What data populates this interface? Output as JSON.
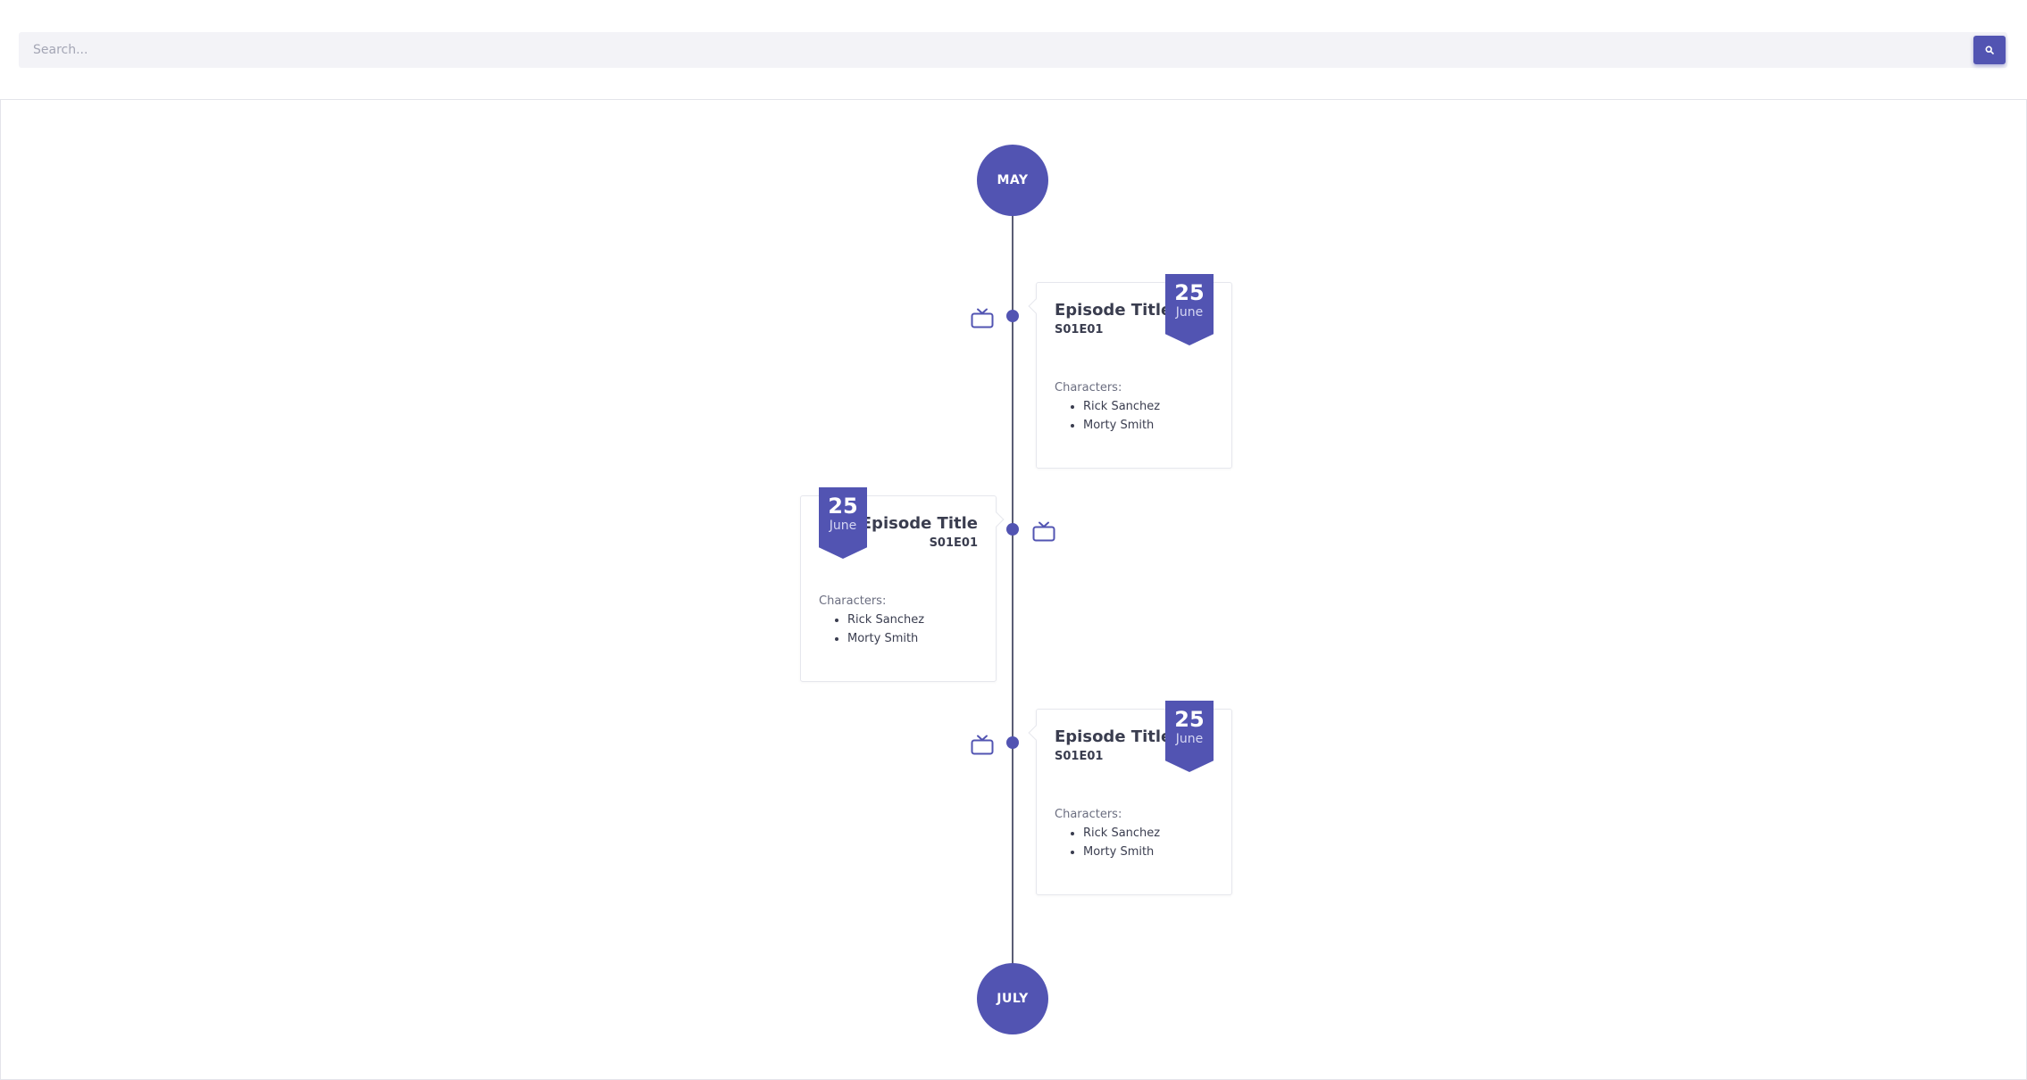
{
  "search": {
    "placeholder": "Search...",
    "value": "",
    "button_icon": "search-icon"
  },
  "theme": {
    "accent": "#5254b2",
    "line": "#5a5d75",
    "text": "#3a3d4f",
    "muted": "#6b6e80"
  },
  "timeline": {
    "start_label": "MAY",
    "end_label": "JULY",
    "episodes": [
      {
        "title": "Episode Title",
        "code": "S01E01",
        "day": "25",
        "month": "June",
        "characters_label": "Characters:",
        "characters": [
          "Rick Sanchez",
          "Morty Smith"
        ],
        "side": "right",
        "icon": "tv-icon"
      },
      {
        "title": "Episode Title",
        "code": "S01E01",
        "day": "25",
        "month": "June",
        "characters_label": "Characters:",
        "characters": [
          "Rick Sanchez",
          "Morty Smith"
        ],
        "side": "left",
        "icon": "tv-icon"
      },
      {
        "title": "Episode Title",
        "code": "S01E01",
        "day": "25",
        "month": "June",
        "characters_label": "Characters:",
        "characters": [
          "Rick Sanchez",
          "Morty Smith"
        ],
        "side": "right",
        "icon": "tv-icon"
      }
    ]
  }
}
